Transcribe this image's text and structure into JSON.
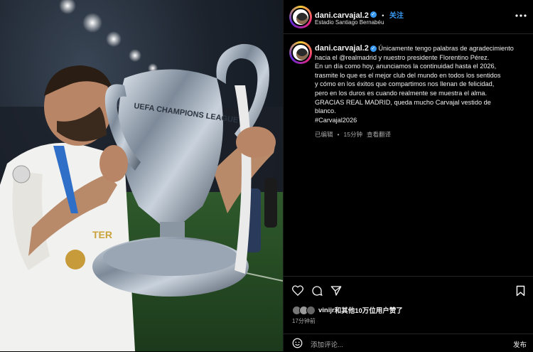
{
  "post": {
    "username": "dani.carvajal.2",
    "verified_mark": "✓",
    "follow_label": "关注",
    "separator": "•",
    "location": "Estadio Santiago Bernabéu",
    "more_icon": "more-horizontal-icon",
    "caption_lines": [
      "Únicamente tengo palabras de agradecimiento",
      "hacia el @realmadrid y nuestro presidente Florentino Pérez.",
      "En un día como hoy, anunciamos la continuidad hasta el 2026,",
      "trasmite lo que es el mejor club del mundo en todos los sentidos",
      "y cómo en los éxitos que compartimos nos llenan de felicidad,",
      "pero en los duros es cuando realmente se muestra el alma.",
      "GRACIAS REAL MADRID, queda mucho Carvajal vestido de",
      "blanco.",
      "#Carvajal2026"
    ],
    "edited_label": "已编辑",
    "time_ago": "15分钟",
    "translate_label": "查看翻译",
    "likes_user": "vinijr",
    "likes_rest": "和其他10万位用户赞了",
    "posted_time": "17分钟前",
    "comment_placeholder": "添加评论...",
    "post_button": "发布"
  },
  "photo": {
    "trophy_text": "UEFA CHAMPIONS LEAGUE",
    "jersey_text": "TER"
  },
  "colors": {
    "accent": "#3897f0",
    "background": "#000000",
    "muted": "#a8a8a8"
  }
}
